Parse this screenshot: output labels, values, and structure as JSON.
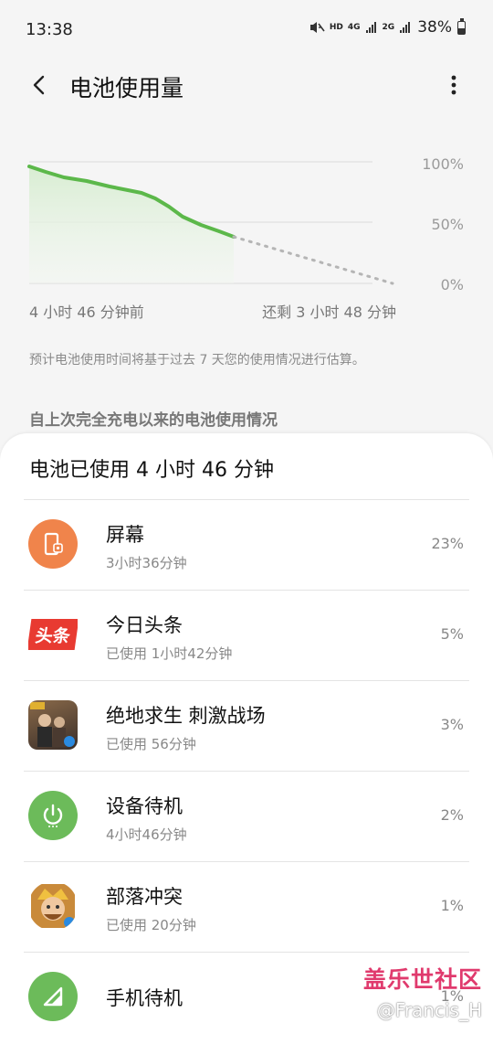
{
  "status_bar": {
    "time": "13:38",
    "battery": "38%",
    "network_1": "HD",
    "network_2": "4G",
    "network_3": "2G"
  },
  "app_bar": {
    "title": "电池使用量"
  },
  "chart": {
    "y_ticks": [
      "100%",
      "50%",
      "0%"
    ],
    "x_left": "4 小时 46 分钟前",
    "x_right": "还剩 3 小时 48 分钟",
    "accent": "#5cb84a",
    "fill": "#e2f1de"
  },
  "note": "预计电池使用时间将基于过去 7 天您的使用情况进行估算。",
  "section_header": "自上次完全充电以来的电池使用情况",
  "card": {
    "title": "电池已使用 4 小时 46 分钟",
    "items": [
      {
        "name": "屏幕",
        "sub": "3小时36分钟",
        "pct": "23%",
        "icon": "phone-screen-icon",
        "color": "#f0844b"
      },
      {
        "name": "今日头条",
        "sub": "已使用 1小时42分钟",
        "pct": "5%",
        "icon": "toutiao-logo",
        "logo_text": "头条",
        "color": "#e83a31"
      },
      {
        "name": "绝地求生 刺激战场",
        "sub": "已使用 56分钟",
        "pct": "3%",
        "icon": "pubg-app-icon",
        "color": "#5a4a3a"
      },
      {
        "name": "设备待机",
        "sub": "4小时46分钟",
        "pct": "2%",
        "icon": "power-icon",
        "color": "#6cbb5a"
      },
      {
        "name": "部落冲突",
        "sub": "已使用 20分钟",
        "pct": "1%",
        "icon": "clash-app-icon",
        "color": "#c98a3a"
      },
      {
        "name": "手机待机",
        "sub": "",
        "pct": "1%",
        "icon": "signal-icon",
        "color": "#6cbb5a"
      }
    ]
  },
  "watermark": {
    "line1": "盖乐世社区",
    "line2": "@Francis_H"
  }
}
